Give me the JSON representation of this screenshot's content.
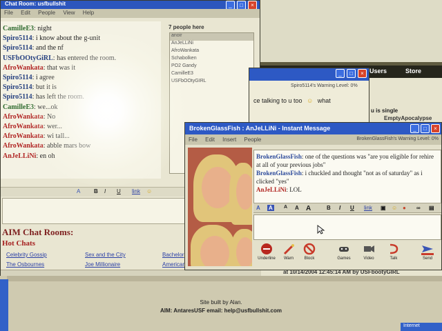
{
  "browser": {
    "nav_items": [
      "Users",
      "Store"
    ],
    "single_text": "u is single",
    "apocalypse_text": "EmptyApocalypse",
    "timestamp": "at 10/14/2004 12:45:14 AM by USFbootyGIRL",
    "built_by": "Site built by Alan.",
    "aim_contact": "AIM: AntaresUSF email: help@usfbullshit.com",
    "taskbar_text": "Internet"
  },
  "chatroom": {
    "title": "Chat Room: usfbullshit",
    "menu": [
      "File",
      "Edit",
      "People",
      "View",
      "Help"
    ],
    "messages": [
      {
        "name": "CamilleE3",
        "color": "green",
        "text": "night"
      },
      {
        "name": "Spiro5114",
        "color": "blue",
        "text": "i know about the g-unit"
      },
      {
        "name": "Spiro5114",
        "color": "blue",
        "text": "and the nf"
      },
      {
        "name": "USFbOOtyGiRL",
        "color": "blue",
        "text": "has entered the room."
      },
      {
        "name": "AfroWankata",
        "color": "red",
        "text": "that was it"
      },
      {
        "name": "Spiro5114",
        "color": "blue",
        "text": "i agree"
      },
      {
        "name": "Spiro5114",
        "color": "blue",
        "text": "but it is"
      },
      {
        "name": "Spiro5114",
        "color": "blue",
        "text": "has left the room."
      },
      {
        "name": "CamilleE3",
        "color": "green",
        "text": "we...ok"
      },
      {
        "name": "AfroWankata",
        "color": "red",
        "text": "No"
      },
      {
        "name": "AfroWankata",
        "color": "red",
        "text": "wer..."
      },
      {
        "name": "AfroWankata",
        "color": "red",
        "text": "wi tall..."
      },
      {
        "name": "AfroWankata",
        "color": "red",
        "text": "abble mars bow"
      },
      {
        "name": "AnJeLLiNi",
        "color": "red",
        "text": "en oh"
      }
    ],
    "people_count": "7 people here",
    "people": [
      "anoir",
      "AnJeLLiNi",
      "AfroWankata",
      "Schabolken",
      "PO2 Gandy",
      "CamilleE3",
      "USFbOOtyGIRL"
    ],
    "rooms_title": "AIM Chat Rooms:",
    "hot_chats": "Hot Chats",
    "rooms": [
      "Celebrity Gossip",
      "Sex and the City",
      "Bachelor",
      "The Osbournes",
      "Joe Millionaire",
      "American"
    ]
  },
  "warnwin": {
    "level": "Spiro5114's Warning Level: 0%",
    "text": "ce talking to u too",
    "emote": "☺",
    "tail": "what"
  },
  "im": {
    "title": "BrokenGlassFish : AnJeLLiNi - Instant Message",
    "menu": [
      "File",
      "Edit",
      "Insert",
      "People"
    ],
    "warning": "BrokenGlassFish's Warning Level: 0%",
    "messages": [
      {
        "name": "BrokenGlassFish",
        "color": "blue",
        "text": ": one of the questions was \"are you eligible for rehire at all of your previous jobs\""
      },
      {
        "name": "BrokenGlassFish",
        "color": "blue",
        "text": ": i chuckled and thought \"not as of saturday\" as i clicked \"yes\""
      },
      {
        "name": "AnJeLLiNi",
        "color": "red",
        "text": ": LOL"
      }
    ],
    "actions": [
      "Underline",
      "Warn",
      "Block",
      "Games",
      "Video",
      "Talk",
      "Send"
    ]
  },
  "colors": {
    "titlebar": "#2d59c4",
    "close": "#d8442a",
    "buddy_blue": "#2d4b9b",
    "buddy_red": "#b0231f"
  }
}
